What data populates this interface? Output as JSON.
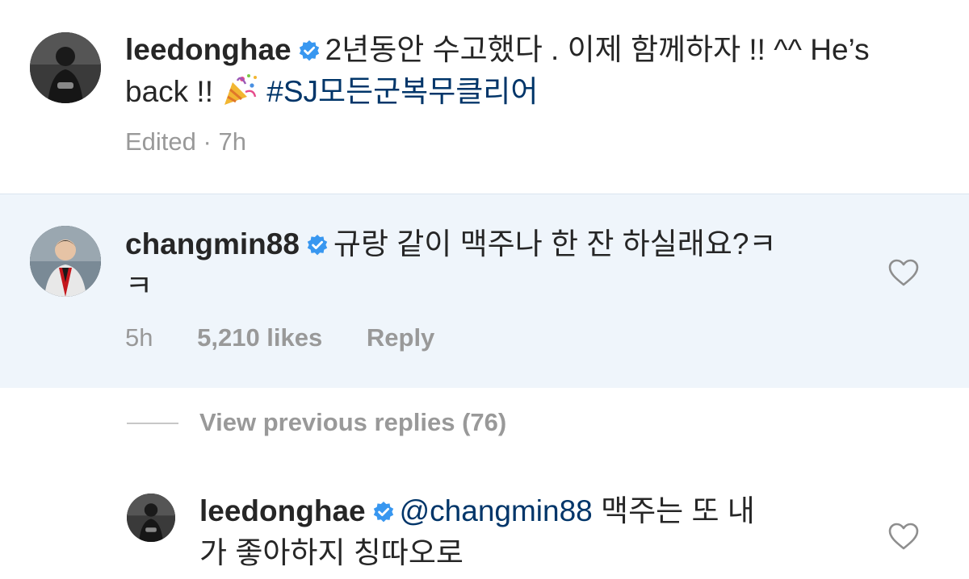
{
  "post": {
    "username": "leedonghae",
    "caption_line1": "2년동안 수고했다 . 이제 함께하자 !! ^^ He’s",
    "caption_line2_prefix": "back !! ",
    "hashtag": "#SJ모든군복무클리어",
    "edited_label": "Edited",
    "separator": "·",
    "time": "7h"
  },
  "comment": {
    "username": "changmin88",
    "text_line1": "규랑 같이 맥주나 한 잔 하실래요?ㅋ",
    "text_line2": "ㅋ",
    "time": "5h",
    "likes": "5,210 likes",
    "reply_label": "Reply"
  },
  "view_previous": {
    "label": "View previous replies (76)"
  },
  "reply": {
    "username": "leedonghae",
    "mention": "@changmin88",
    "text_line1_suffix": " 맥주는 또 내",
    "text_line2": "가 좋아하지 칭따오로"
  },
  "icons": {
    "verified": "verified-badge-icon",
    "heart": "heart-outline-icon",
    "party": "party-popper-emoji"
  },
  "colors": {
    "verified_blue": "#3897f0",
    "hashtag_blue": "#003569",
    "meta_gray": "#999999",
    "highlight_bg": "#eff5fb"
  }
}
